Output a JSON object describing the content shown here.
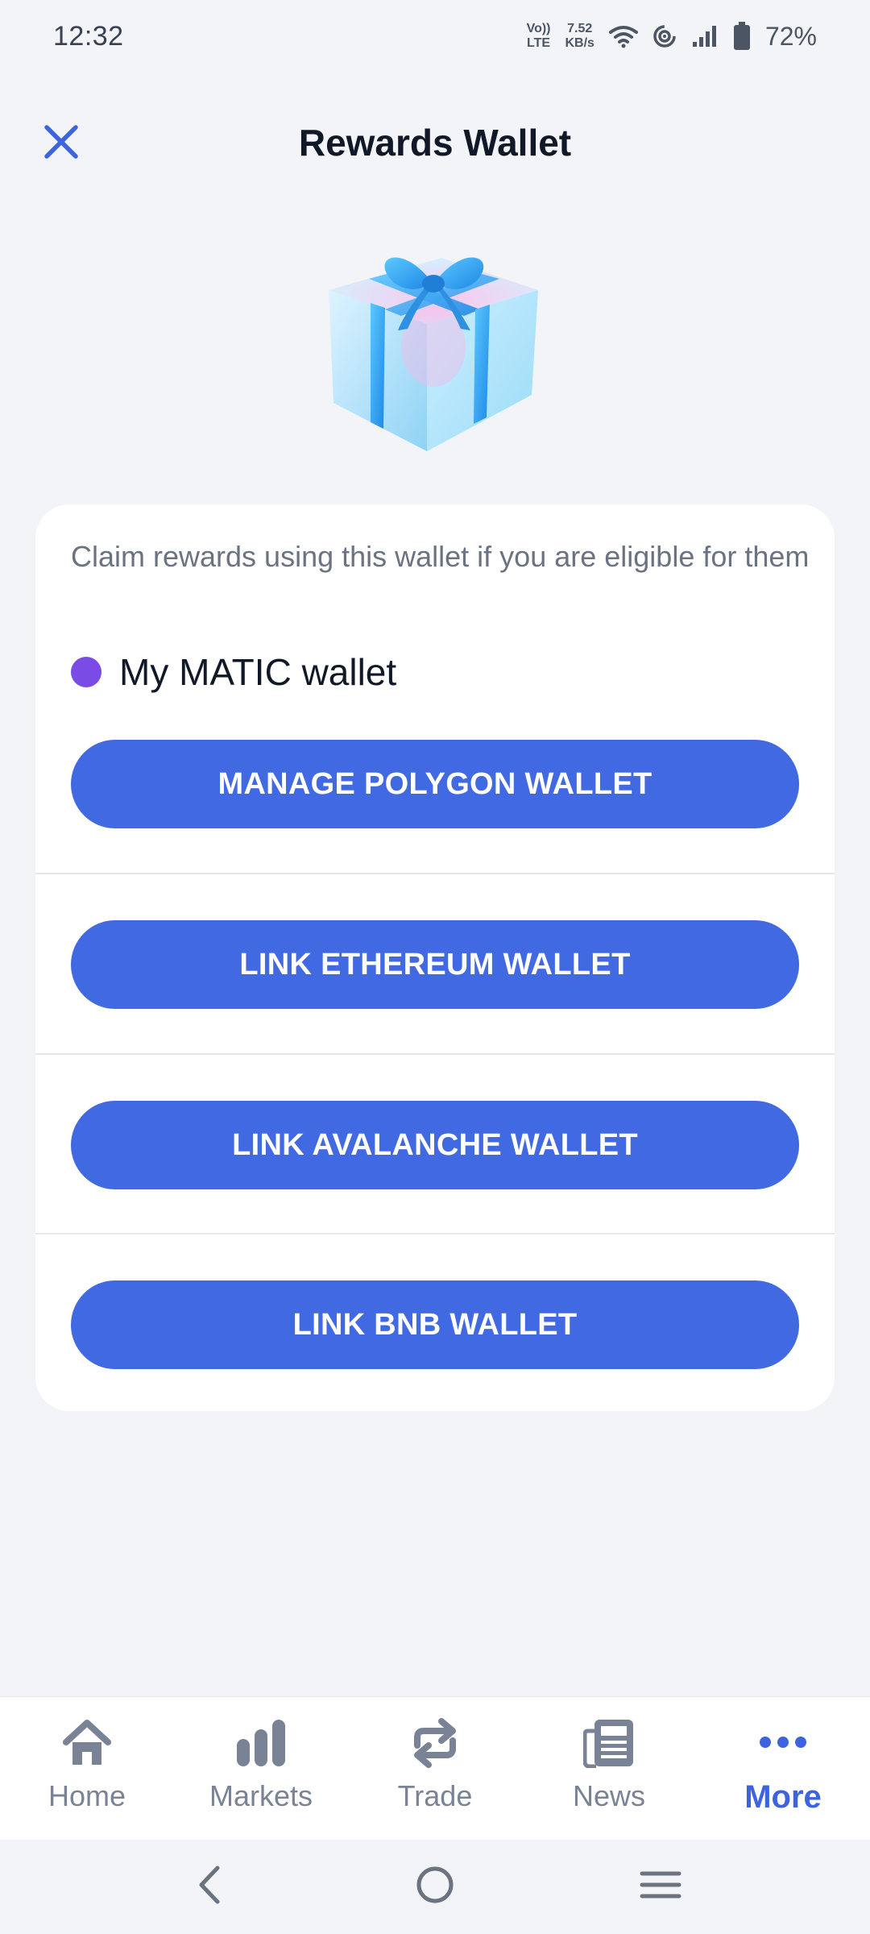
{
  "status_bar": {
    "time": "12:32",
    "net_top": "Vo))",
    "net_bottom": "LTE",
    "speed_value": "7.52",
    "speed_unit": "KB/s",
    "battery": "72%"
  },
  "header": {
    "title": "Rewards Wallet",
    "close_icon": "close-icon"
  },
  "card": {
    "intro": "Claim rewards using this wallet if you are eligible for them",
    "wallet_name": "My MATIC wallet",
    "wallet_dot_color": "#7B4BE6",
    "buttons": [
      {
        "label": "MANAGE POLYGON WALLET"
      },
      {
        "label": "LINK ETHEREUM WALLET"
      },
      {
        "label": "LINK AVALANCHE WALLET"
      },
      {
        "label": "LINK BNB WALLET"
      }
    ]
  },
  "bottom_nav": {
    "items": [
      {
        "label": "Home",
        "icon": "home-icon",
        "active": false
      },
      {
        "label": "Markets",
        "icon": "bar-chart-icon",
        "active": false
      },
      {
        "label": "Trade",
        "icon": "swap-icon",
        "active": false
      },
      {
        "label": "News",
        "icon": "newspaper-icon",
        "active": false
      },
      {
        "label": "More",
        "icon": "more-dots-icon",
        "active": true
      }
    ]
  },
  "colors": {
    "accent": "#4169E1",
    "background": "#F2F4F8",
    "nav_inactive": "#7A8396",
    "nav_active": "#3D63DD"
  }
}
